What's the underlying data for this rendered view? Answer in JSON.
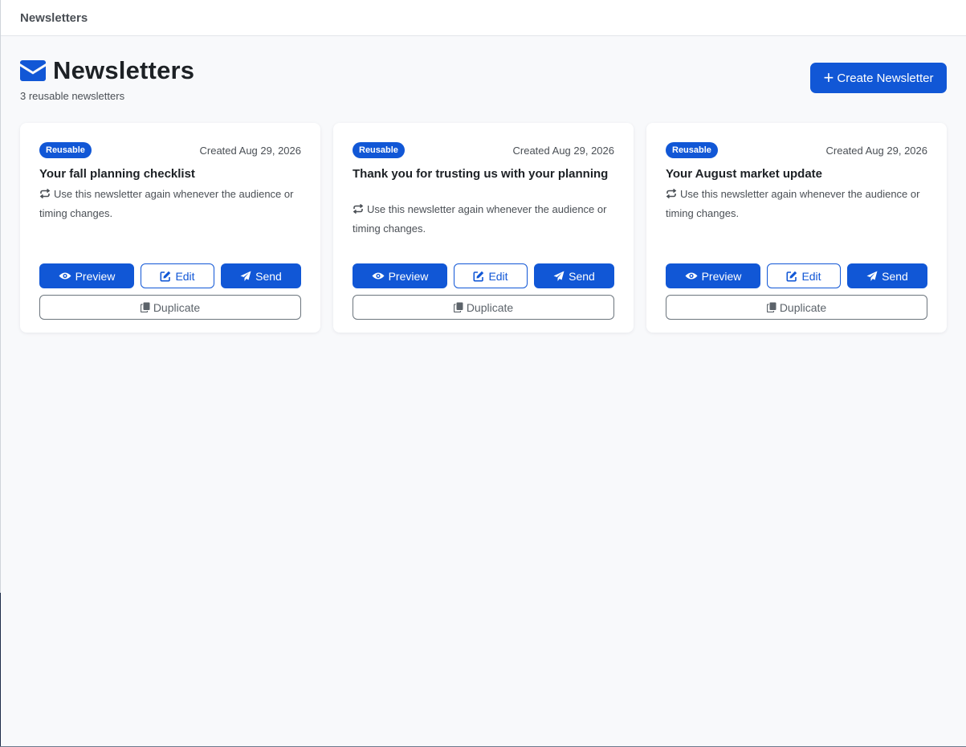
{
  "topbar": {
    "title": "Newsletters"
  },
  "header": {
    "title": "Newsletters",
    "subtitle": "3 reusable newsletters",
    "create_button": "Create Newsletter",
    "icon": "envelope-icon"
  },
  "colors": {
    "accent": "#1157d6",
    "background": "#f8f9fb",
    "muted_text": "#4a4f55"
  },
  "cards": [
    {
      "badge": "Reusable",
      "created": "Created Aug 29, 2026",
      "title": "Your fall planning checklist",
      "description": "Use this newsletter again whenever the audience or timing changes.",
      "actions": {
        "preview": "Preview",
        "edit": "Edit",
        "send": "Send",
        "duplicate": "Duplicate"
      }
    },
    {
      "badge": "Reusable",
      "created": "Created Aug 29, 2026",
      "title": "Thank you for trusting us with your planning",
      "description": "Use this newsletter again whenever the audience or timing changes.",
      "actions": {
        "preview": "Preview",
        "edit": "Edit",
        "send": "Send",
        "duplicate": "Duplicate"
      }
    },
    {
      "badge": "Reusable",
      "created": "Created Aug 29, 2026",
      "title": "Your August market update",
      "description": "Use this newsletter again whenever the audience or timing changes.",
      "actions": {
        "preview": "Preview",
        "edit": "Edit",
        "send": "Send",
        "duplicate": "Duplicate"
      }
    }
  ]
}
